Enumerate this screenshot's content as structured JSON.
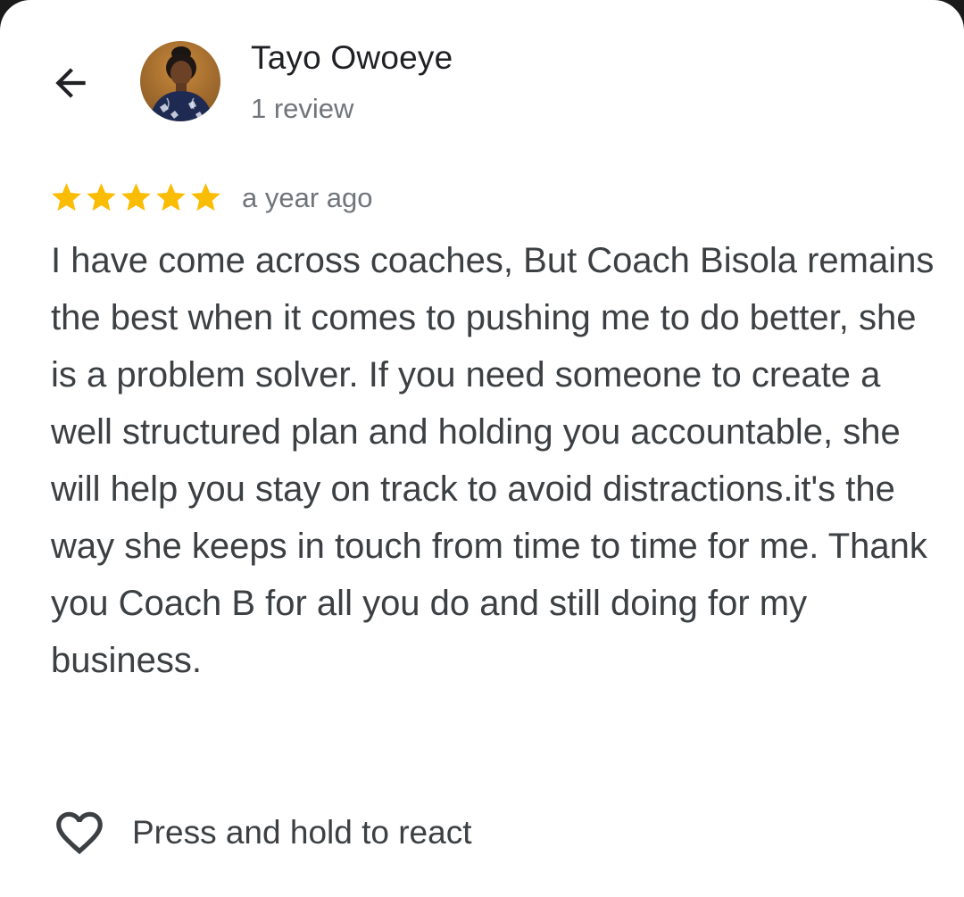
{
  "header": {
    "back_icon": "arrow-back-icon",
    "author_name": "Tayo Owoeye",
    "author_meta": "1 review",
    "avatar_icon": "user-avatar"
  },
  "review": {
    "rating": 5,
    "rating_max": 5,
    "star_color": "#fbbc04",
    "time": "a year ago",
    "text": "I have come across coaches, But Coach Bisola remains the best when it comes to pushing me to do better, she is a problem solver. If you need someone to create a well structured plan and holding you accountable, she will help you stay on track to avoid distractions.it's the way she keeps in touch from time to time for me. Thank you Coach B for all you do and still doing for my business."
  },
  "actions": {
    "react_icon": "heart-outline-icon",
    "react_label": "Press and hold to react"
  }
}
